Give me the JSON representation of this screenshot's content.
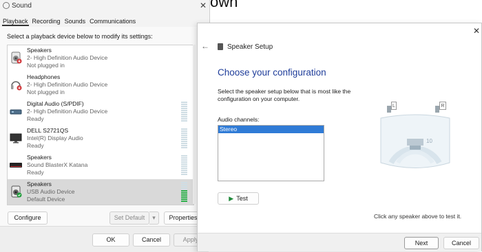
{
  "background": {
    "title_fragment": "own"
  },
  "sound_dialog": {
    "title": "Sound",
    "close_glyph": "✕",
    "tabs": [
      "Playback",
      "Recording",
      "Sounds",
      "Communications"
    ],
    "instruction": "Select a playback device below to modify its settings:",
    "devices": [
      {
        "name": "Speakers",
        "description": "2- High Definition Audio Device",
        "status": "Not plugged in",
        "icon": "speaker-icon",
        "badge": "red-down-arrow"
      },
      {
        "name": "Headphones",
        "description": "2- High Definition Audio Device",
        "status": "Not plugged in",
        "icon": "headphones-icon",
        "badge": "red-down-arrow"
      },
      {
        "name": "Digital Audio (S/PDIF)",
        "description": "2- High Definition Audio Device",
        "status": "Ready",
        "icon": "digital-audio-icon"
      },
      {
        "name": "DELL S2721QS",
        "description": "Intel(R) Display Audio",
        "status": "Ready",
        "icon": "monitor-icon"
      },
      {
        "name": "Speakers",
        "description": "Sound BlasterX Katana",
        "status": "Ready",
        "icon": "soundbar-icon"
      },
      {
        "name": "Speakers",
        "description": "USB Audio Device",
        "status": "Default Device",
        "icon": "speaker-icon",
        "badge": "green-check",
        "selected": true
      }
    ],
    "buttons": {
      "configure": "Configure",
      "set_default": "Set Default",
      "properties": "Properties",
      "ok": "OK",
      "cancel": "Cancel",
      "apply": "Apply"
    }
  },
  "speaker_setup": {
    "title": "Speaker Setup",
    "close_glyph": "✕",
    "back_glyph": "←",
    "heading": "Choose your configuration",
    "description": "Select the speaker setup below that is most like the configuration on your computer.",
    "channels_label": "Audio channels:",
    "channels": [
      {
        "label": "Stereo",
        "selected": true
      }
    ],
    "test_button": "Test",
    "speaker_labels": {
      "left": "L",
      "right": "R"
    },
    "hint": "Click any speaker above to test it.",
    "buttons": {
      "next": "Next",
      "cancel": "Cancel"
    },
    "colors": {
      "heading": "#1f3d9a",
      "selection": "#2f7bd6"
    }
  }
}
